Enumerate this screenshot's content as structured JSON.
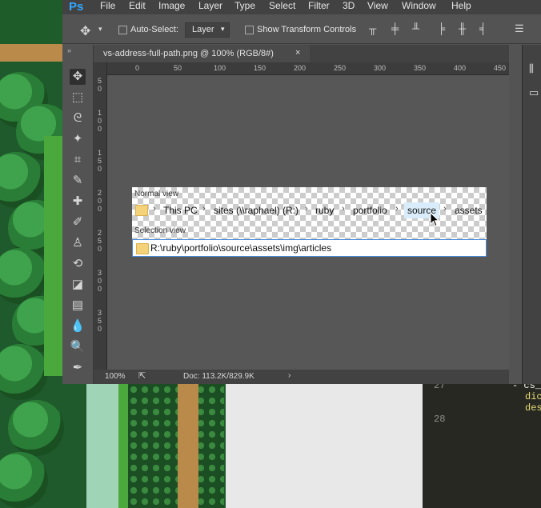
{
  "app": {
    "logo": "Ps"
  },
  "menu": [
    "File",
    "Edit",
    "Image",
    "Layer",
    "Type",
    "Select",
    "Filter",
    "3D",
    "View",
    "Window",
    "Help"
  ],
  "options": {
    "auto_select_label": "Auto-Select:",
    "auto_select_target": "Layer",
    "show_transform_label": "Show Transform Controls"
  },
  "document": {
    "tab_title": "vs-address-full-path.png @ 100% (RGB/8#)",
    "close": "×"
  },
  "ruler": {
    "h_ticks": [
      "0",
      "50",
      "100",
      "150",
      "200",
      "250",
      "300",
      "350",
      "400",
      "450"
    ],
    "v_ticks": [
      "5",
      "0",
      "1",
      "0",
      "0",
      "1",
      "5",
      "0",
      "2",
      "0",
      "0",
      "2",
      "5",
      "0",
      "3",
      "0",
      "0",
      "3",
      "5",
      "0"
    ]
  },
  "image": {
    "normal_view_label": "Normal view",
    "selection_view_label": "Selection view",
    "breadcrumbs": [
      "This PC",
      "sites (\\\\raphael) (R:)",
      "ruby",
      "portfolio",
      "source",
      "assets"
    ],
    "address_path": "R:\\ruby\\portfolio\\source\\assets\\img\\articles"
  },
  "status": {
    "zoom": "100%",
    "doc": "Doc: 113.2K/829.9K"
  },
  "editor": {
    "line_numbers": [
      "27",
      "28"
    ],
    "code_lines": [
      "- cs_",
      "dic",
      "des"
    ]
  },
  "colors": {
    "accent": "#31a8ff",
    "selection_border": "#4a8ad8"
  }
}
